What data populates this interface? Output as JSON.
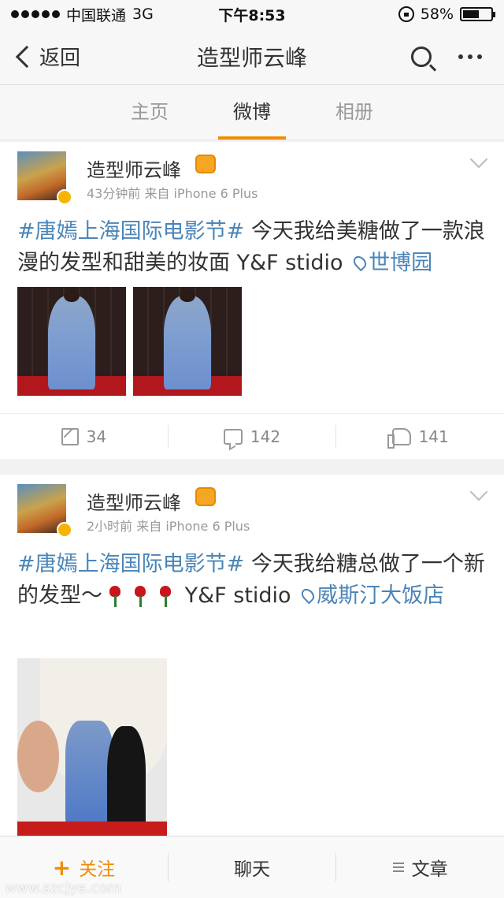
{
  "status_bar": {
    "carrier": "中国联通",
    "network": "3G",
    "time": "下午8:53",
    "battery": "58%",
    "battery_level": 0.58
  },
  "nav": {
    "back_label": "返回",
    "title": "造型师云峰"
  },
  "tabs": [
    {
      "label": "主页",
      "active": false
    },
    {
      "label": "微博",
      "active": true
    },
    {
      "label": "相册",
      "active": false
    }
  ],
  "posts": [
    {
      "user": "造型师云峰",
      "meta": "43分钟前  来自 iPhone 6 Plus",
      "hashtag": "#唐嫣上海国际电影节#",
      "text": " 今天我给美糖做了一款浪漫的发型和甜美的妆面 Y&F stidio ",
      "place": "世博园",
      "actions": {
        "repost": "34",
        "comment": "142",
        "like": "141"
      }
    },
    {
      "user": "造型师云峰",
      "meta": "2小时前  来自 iPhone 6 Plus",
      "hashtag": "#唐嫣上海国际电影节#",
      "text": " 今天我给糖总做了一个新的发型～",
      "text_after": "Y&F stidio ",
      "place": "威斯汀大饭店"
    }
  ],
  "bottom_bar": {
    "follow": "关注",
    "chat": "聊天",
    "article": "文章"
  },
  "watermark": "www.szcjye.com",
  "colors": {
    "accent": "#f18d00",
    "link": "#4a85b8",
    "verified": "#f6b400"
  }
}
